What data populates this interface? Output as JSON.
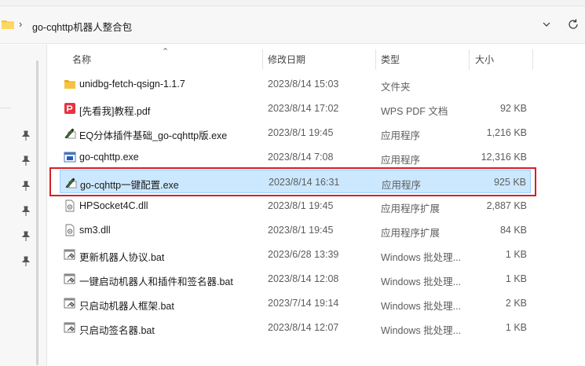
{
  "address_bar": {
    "path": "go-cqhttp机器人整合包",
    "separator": "›"
  },
  "columns": {
    "name": "名称",
    "date": "修改日期",
    "type": "类型",
    "size": "大小"
  },
  "files": [
    {
      "name": "unidbg-fetch-qsign-1.1.7",
      "date": "2023/8/14 15:03",
      "type": "文件夹",
      "size": "",
      "icon": "folder-icon"
    },
    {
      "name": "[先看我]教程.pdf",
      "date": "2023/8/14 17:02",
      "type": "WPS PDF 文档",
      "size": "92 KB",
      "icon": "pdf-icon"
    },
    {
      "name": "EQ分体插件基础_go-cqhttp版.exe",
      "date": "2023/8/1 19:45",
      "type": "应用程序",
      "size": "1,216 KB",
      "icon": "exe-pen-icon"
    },
    {
      "name": "go-cqhttp.exe",
      "date": "2023/8/14 7:08",
      "type": "应用程序",
      "size": "12,316 KB",
      "icon": "exe-window-icon"
    },
    {
      "name": "go-cqhttp一键配置.exe",
      "date": "2023/8/14 16:31",
      "type": "应用程序",
      "size": "925 KB",
      "icon": "exe-pen-icon",
      "selected": true
    },
    {
      "name": "HPSocket4C.dll",
      "date": "2023/8/1 19:45",
      "type": "应用程序扩展",
      "size": "2,887 KB",
      "icon": "dll-icon"
    },
    {
      "name": "sm3.dll",
      "date": "2023/8/1 19:45",
      "type": "应用程序扩展",
      "size": "84 KB",
      "icon": "dll-icon"
    },
    {
      "name": "更新机器人协议.bat",
      "date": "2023/6/28 13:39",
      "type": "Windows 批处理...",
      "size": "1 KB",
      "icon": "bat-icon"
    },
    {
      "name": "一键启动机器人和插件和签名器.bat",
      "date": "2023/8/14 12:08",
      "type": "Windows 批处理...",
      "size": "1 KB",
      "icon": "bat-icon"
    },
    {
      "name": "只启动机器人框架.bat",
      "date": "2023/7/14 19:14",
      "type": "Windows 批处理...",
      "size": "2 KB",
      "icon": "bat-icon"
    },
    {
      "name": "只启动签名器.bat",
      "date": "2023/8/14 12:07",
      "type": "Windows 批处理...",
      "size": "1 KB",
      "icon": "bat-icon"
    }
  ],
  "colors": {
    "selection_bg": "#cce8ff",
    "selection_border": "#99d1ff",
    "highlight_box": "#d61f26",
    "folder_yellow": "#f5c443",
    "pdf_red": "#e5343f"
  }
}
